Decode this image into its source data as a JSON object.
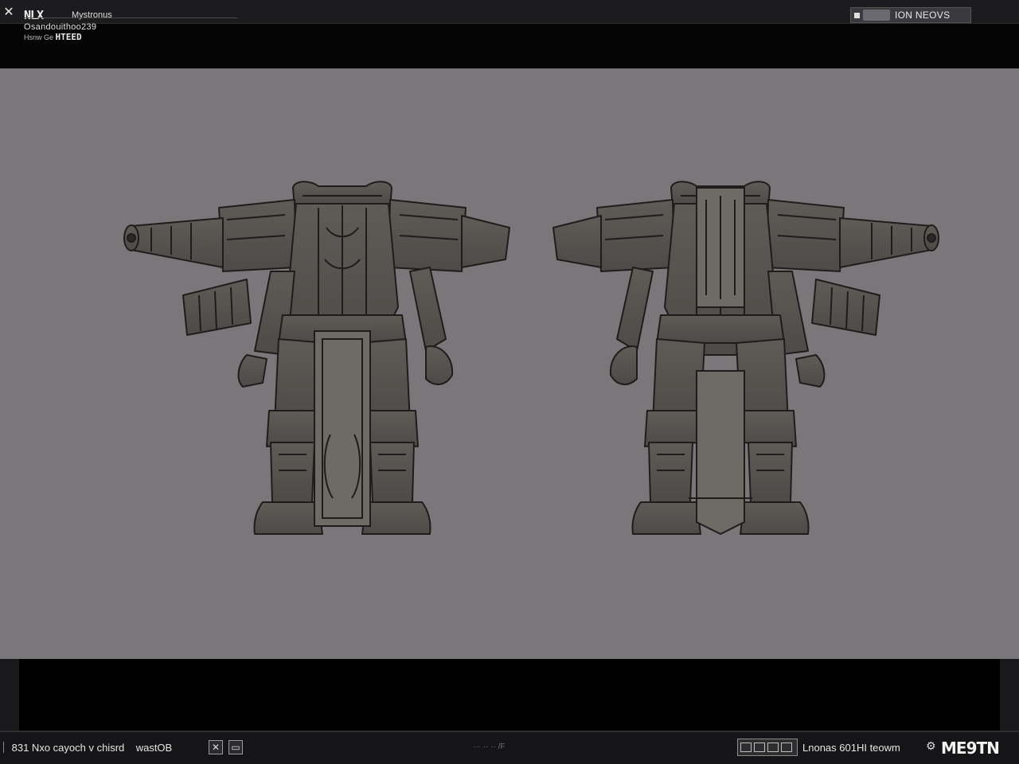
{
  "header": {
    "close_icon": "close-icon",
    "logo": "NLX",
    "app_name": "Mystronus",
    "subtitle": "Osandouithoo239",
    "subtitle2_a": "Hsnw Ge",
    "subtitle2_b": "HTEED",
    "view_toggle_label": "ION NEOVS"
  },
  "viewport": {
    "background": "#7a777b",
    "models": [
      {
        "name": "front-view"
      },
      {
        "name": "back-view"
      }
    ]
  },
  "statusbar": {
    "left_text": "831 Nxo cayoch v chisrd",
    "left_text2": "wastOB",
    "icon_a": "x-box-icon",
    "icon_b": "monitor-icon",
    "mid_text": "··· ·· ·· /F",
    "right_text": "Lnonas 601HI teowm",
    "gear_icon": "gear-icon",
    "brand": "ME9TN"
  }
}
